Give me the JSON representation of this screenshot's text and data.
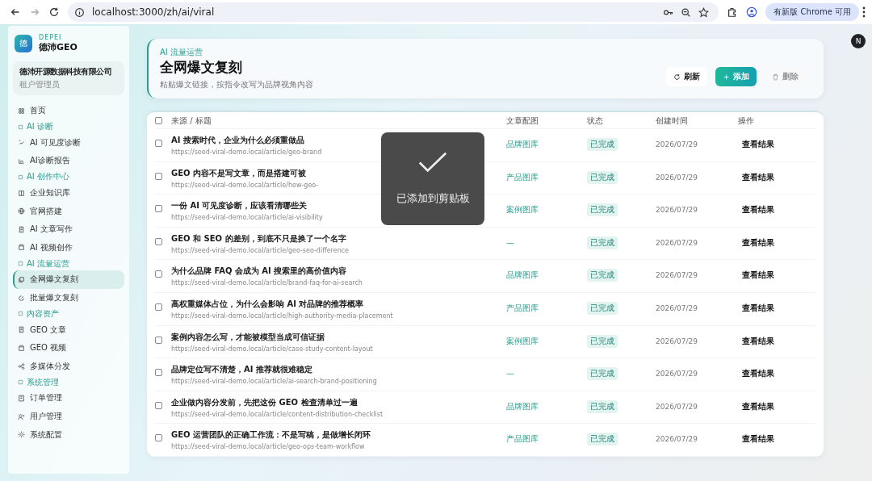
{
  "browser": {
    "url": "localhost:3000/zh/ai/viral",
    "update_button": "有新版 Chrome 可用"
  },
  "sidebar": {
    "brand_small": "DEPEI",
    "brand": "德沛GEO",
    "logo_char": "德",
    "company": "德沛开源数据科技有限公司",
    "role": "租户管理员",
    "items": [
      {
        "kind": "item",
        "label": "首页",
        "selected": false
      },
      {
        "kind": "section",
        "label": "AI 诊断"
      },
      {
        "kind": "item",
        "label": "AI 可见度诊断",
        "selected": false
      },
      {
        "kind": "item",
        "label": "AI诊断报告",
        "selected": false
      },
      {
        "kind": "section",
        "label": "AI 创作中心"
      },
      {
        "kind": "item",
        "label": "企业知识库",
        "selected": false
      },
      {
        "kind": "item",
        "label": "官网搭建",
        "selected": false
      },
      {
        "kind": "item",
        "label": "AI 文章写作",
        "selected": false
      },
      {
        "kind": "item",
        "label": "AI 视频创作",
        "selected": false
      },
      {
        "kind": "section",
        "label": "AI 流量运营"
      },
      {
        "kind": "item",
        "label": "全网爆文复刻",
        "selected": true
      },
      {
        "kind": "item",
        "label": "批量爆文复刻",
        "selected": false
      },
      {
        "kind": "section",
        "label": "内容资产"
      },
      {
        "kind": "item",
        "label": "GEO 文章",
        "selected": false
      },
      {
        "kind": "item",
        "label": "GEO 视频",
        "selected": false
      },
      {
        "kind": "item",
        "label": "多媒体分发",
        "selected": false
      },
      {
        "kind": "section",
        "label": "系统管理"
      },
      {
        "kind": "item",
        "label": "订单管理",
        "selected": false
      },
      {
        "kind": "item",
        "label": "用户管理",
        "selected": false
      },
      {
        "kind": "item",
        "label": "系统配置",
        "selected": false
      }
    ]
  },
  "header": {
    "eyebrow": "AI 流量运营",
    "title": "全网爆文复刻",
    "subtitle": "粘贴爆文链接，按指令改写为品牌视角内容",
    "buttons": [
      {
        "kind": "refresh",
        "label": "刷新"
      },
      {
        "kind": "add",
        "label": "添加"
      },
      {
        "kind": "delete",
        "label": "删除",
        "disabled": true
      }
    ]
  },
  "avatar": "N",
  "table": {
    "select_all_checked": false,
    "columns": [
      "来源 / 标题",
      "文章配图",
      "状态",
      "创建时间",
      "操作"
    ],
    "rows": [
      {
        "checked": false,
        "title": "AI 搜索时代，企业为什么必须重做品",
        "url": "https://seed-viral-demo.local/article/geo-brand",
        "image": "品牌图库",
        "status": "已完成",
        "created": "2026/07/29",
        "action": "查看结果"
      },
      {
        "checked": false,
        "title": "GEO 内容不是写文章，而是搭建可被",
        "url": "https://seed-viral-demo.local/article/how-geo-",
        "image": "产品图库",
        "status": "已完成",
        "created": "2026/07/29",
        "action": "查看结果"
      },
      {
        "checked": false,
        "title": "一份 AI 可见度诊断，应该看清哪些关",
        "url": "https://seed-viral-demo.local/article/ai-visibility",
        "image": "案例图库",
        "status": "已完成",
        "created": "2026/07/29",
        "action": "查看结果"
      },
      {
        "checked": false,
        "title": "GEO 和 SEO 的差别，到底不只是换了一个名字",
        "url": "https://seed-viral-demo.local/article/geo-seo-difference",
        "image": "—",
        "status": "已完成",
        "created": "2026/07/29",
        "action": "查看结果"
      },
      {
        "checked": false,
        "title": "为什么品牌 FAQ 会成为 AI 搜索里的高价值内容",
        "url": "https://seed-viral-demo.local/article/brand-faq-for-ai-search",
        "image": "品牌图库",
        "status": "已完成",
        "created": "2026/07/29",
        "action": "查看结果"
      },
      {
        "checked": false,
        "title": "高权重媒体占位，为什么会影响 AI 对品牌的推荐概率",
        "url": "https://seed-viral-demo.local/article/high-authority-media-placement",
        "image": "产品图库",
        "status": "已完成",
        "created": "2026/07/29",
        "action": "查看结果"
      },
      {
        "checked": false,
        "title": "案例内容怎么写，才能被模型当成可信证据",
        "url": "https://seed-viral-demo.local/article/case-study-content-layout",
        "image": "案例图库",
        "status": "已完成",
        "created": "2026/07/29",
        "action": "查看结果"
      },
      {
        "checked": false,
        "title": "品牌定位写不清楚，AI 推荐就很难稳定",
        "url": "https://seed-viral-demo.local/article/ai-search-brand-positioning",
        "image": "—",
        "status": "已完成",
        "created": "2026/07/29",
        "action": "查看结果"
      },
      {
        "checked": false,
        "title": "企业做内容分发前，先把这份 GEO 检查清单过一遍",
        "url": "https://seed-viral-demo.local/article/content-distribution-checklist",
        "image": "品牌图库",
        "status": "已完成",
        "created": "2026/07/29",
        "action": "查看结果"
      },
      {
        "checked": false,
        "title": "GEO 运营团队的正确工作流：不是写稿，是做增长闭环",
        "url": "https://seed-viral-demo.local/article/geo-ops-team-workflow",
        "image": "产品图库",
        "status": "已完成",
        "created": "2026/07/29",
        "action": "查看结果"
      }
    ]
  },
  "toast": {
    "message": "已添加到剪贴板"
  }
}
